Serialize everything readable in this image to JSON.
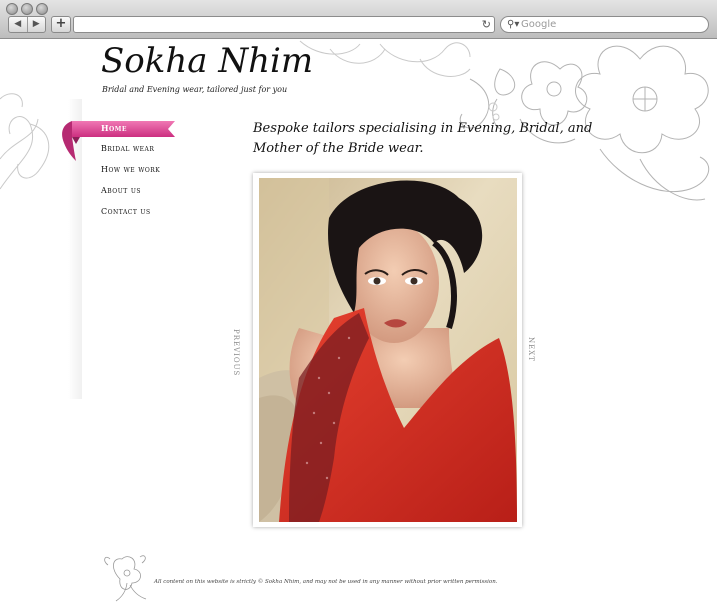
{
  "browser": {
    "back_icon": "back-arrow-icon",
    "forward_icon": "forward-arrow-icon",
    "new_tab_label": "+",
    "url": "",
    "reload_icon": "reload-icon",
    "search_placeholder": "Google"
  },
  "site": {
    "logo": "Sokha Nhim",
    "tagline": "Bridal and Evening wear, tailored just for you"
  },
  "nav": {
    "items": [
      {
        "label": "Home",
        "active": true
      },
      {
        "label": "Bridal wear",
        "active": false
      },
      {
        "label": "How we work",
        "active": false
      },
      {
        "label": "About us",
        "active": false
      },
      {
        "label": "Contact us",
        "active": false
      }
    ],
    "active_color": "#e0559a"
  },
  "main": {
    "heading": "Bespoke tailors specialising in Evening, Bridal, and Mother of the Bride wear.",
    "gallery": {
      "prev_label": "PREVIOUS",
      "next_label": "NEXT"
    }
  },
  "footer": {
    "text": "All content on this website is strictly © Sokha Nhim, and may not be used in any manner without prior written permission."
  }
}
